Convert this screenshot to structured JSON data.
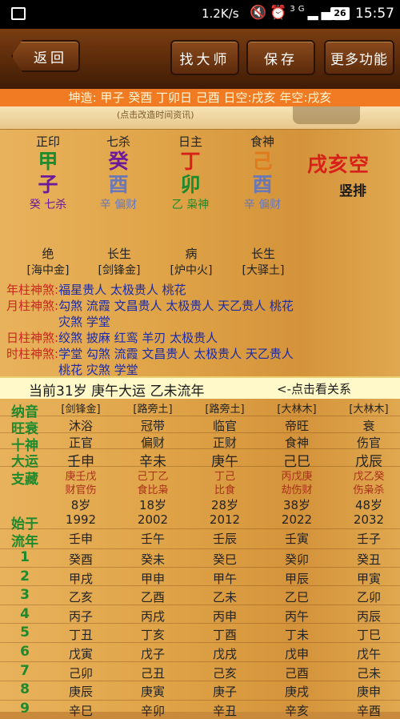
{
  "status_bar": {
    "speed": "1.2K/s",
    "signal": "3G",
    "battery": "26",
    "time": "15:57"
  },
  "toolbar": {
    "back": "返回",
    "find_master": "找大师",
    "save": "保存",
    "more": "更多功能"
  },
  "title": "坤造: 甲子 癸酉 丁卯日 己酉   日空:戌亥 年空:戌亥",
  "hint_line": "(点击改造时间资讯)",
  "pillars": [
    {
      "shishen": "正印",
      "gan": "甲",
      "zhi": "子",
      "gan_color": "#1e8a2e",
      "zhi_color": "#6a1a9a",
      "cang": "癸 七杀",
      "nayin_ss": "绝",
      "nayin": "[海中金]"
    },
    {
      "shishen": "七杀",
      "gan": "癸",
      "zhi": "酉",
      "gan_color": "#6a1a9a",
      "zhi_color": "#6a78b8",
      "cang": "辛 偏财",
      "nayin_ss": "长生",
      "nayin": "[剑锋金]"
    },
    {
      "shishen": "日主",
      "gan": "丁",
      "zhi": "卯",
      "gan_color": "#d8201a",
      "zhi_color": "#1e8a2e",
      "cang": "乙 枭神",
      "nayin_ss": "病",
      "nayin": "[炉中火]"
    },
    {
      "shishen": "食神",
      "gan": "己",
      "zhi": "酉",
      "gan_color": "#e07a1a",
      "zhi_color": "#6a78b8",
      "cang": "辛 偏财",
      "nayin_ss": "长生",
      "nayin": "[大驿土]"
    }
  ],
  "kong": "戌亥空",
  "vertical": "竖排",
  "shensha": [
    {
      "label": "年柱神煞:",
      "value": "福星贵人 太极贵人 桃花"
    },
    {
      "label": "月柱神煞:",
      "value": "勾煞 流霞 文昌贵人 太极贵人 天乙贵人 桃花",
      "value2": "灾煞 学堂"
    },
    {
      "label": "日柱神煞:",
      "value": "绞煞 披麻 红鸾 羊刃 太极贵人"
    },
    {
      "label": "时柱神煞:",
      "value": "学堂 勾煞 流霞 文昌贵人 太极贵人 天乙贵人",
      "value2": "桃花 灾煞 学堂"
    }
  ],
  "current": {
    "text": "当前31岁 庚午大运 乙未流年",
    "hint": "<-点击看关系"
  },
  "luck": {
    "row_labels": [
      "纳音",
      "旺衰",
      "十神",
      "大运",
      "支藏",
      "始于",
      "流年"
    ],
    "columns": [
      {
        "nayin": "[剑锋金]",
        "wangshuai": "沐浴",
        "shishen": "正官",
        "dayun": "壬申",
        "zhicang1": "庚壬戊",
        "zhicang2": "财官伤",
        "age": "8岁",
        "start": "1992",
        "liunian": "壬申",
        "years": [
          "癸酉",
          "甲戌",
          "乙亥",
          "丙子",
          "丁丑",
          "戊寅",
          "己卯",
          "庚辰",
          "辛巳"
        ]
      },
      {
        "nayin": "[路旁土]",
        "wangshuai": "冠带",
        "shishen": "偏财",
        "dayun": "辛未",
        "zhicang1": "己丁乙",
        "zhicang2": "食比枭",
        "age": "18岁",
        "start": "2002",
        "liunian": "壬午",
        "years": [
          "癸未",
          "甲申",
          "乙酉",
          "丙戌",
          "丁亥",
          "戊子",
          "己丑",
          "庚寅",
          "辛卯"
        ]
      },
      {
        "nayin": "[路旁土]",
        "wangshuai": "临官",
        "shishen": "正财",
        "dayun": "庚午",
        "zhicang1": "丁己",
        "zhicang2": "比食",
        "age": "28岁",
        "start": "2012",
        "liunian": "壬辰",
        "years": [
          "癸巳",
          "甲午",
          "乙未",
          "丙申",
          "丁酉",
          "戊戌",
          "己亥",
          "庚子",
          "辛丑"
        ]
      },
      {
        "nayin": "[大林木]",
        "wangshuai": "帝旺",
        "shishen": "食神",
        "dayun": "己巳",
        "zhicang1": "丙戊庚",
        "zhicang2": "劫伤财",
        "age": "38岁",
        "start": "2022",
        "liunian": "壬寅",
        "years": [
          "癸卯",
          "甲辰",
          "乙巳",
          "丙午",
          "丁未",
          "戊申",
          "己酉",
          "庚戌",
          "辛亥"
        ]
      },
      {
        "nayin": "[大林木]",
        "wangshuai": "衰",
        "shishen": "伤官",
        "dayun": "戊辰",
        "zhicang1": "戊乙癸",
        "zhicang2": "伤枭杀",
        "age": "48岁",
        "start": "2032",
        "liunian": "壬子",
        "years": [
          "癸丑",
          "甲寅",
          "乙卯",
          "丙辰",
          "丁巳",
          "戊午",
          "己未",
          "庚申",
          "辛酉"
        ]
      }
    ],
    "year_index": [
      "1",
      "2",
      "3",
      "4",
      "5",
      "6",
      "7",
      "8",
      "9"
    ]
  }
}
